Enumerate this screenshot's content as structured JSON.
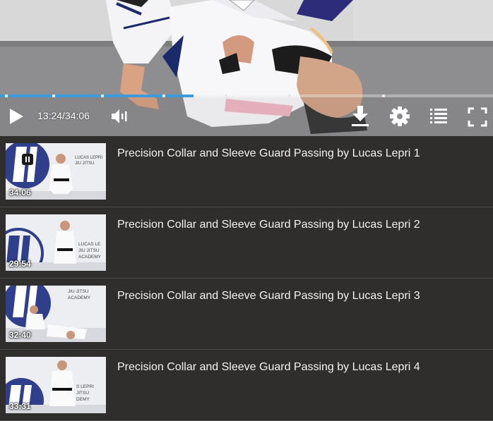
{
  "player": {
    "current_time": "13:24",
    "separator": "/",
    "total_time": "34:06",
    "progress_fraction": 0.393,
    "chapter_marks": [
      0.01,
      0.106,
      0.205,
      0.33,
      0.455,
      0.585,
      0.775
    ],
    "icons": {
      "play": "play-icon",
      "volume": "volume-icon",
      "download": "download-icon",
      "settings": "gear-icon",
      "playlist": "list-icon",
      "fullscreen": "fullscreen-icon"
    },
    "accent_color": "#3d9bdc"
  },
  "playlist": {
    "items": [
      {
        "title": "Precision Collar and Sleeve Guard Passing by Lucas Lepri 1",
        "duration": "34:06",
        "now_playing": true
      },
      {
        "title": "Precision Collar and Sleeve Guard Passing by Lucas Lepri 2",
        "duration": "29:54",
        "now_playing": false
      },
      {
        "title": "Precision Collar and Sleeve Guard Passing by Lucas Lepri 3",
        "duration": "32:40",
        "now_playing": false
      },
      {
        "title": "Precision Collar and Sleeve Guard Passing by Lucas Lepri 4",
        "duration": "33:31",
        "now_playing": false
      }
    ]
  }
}
